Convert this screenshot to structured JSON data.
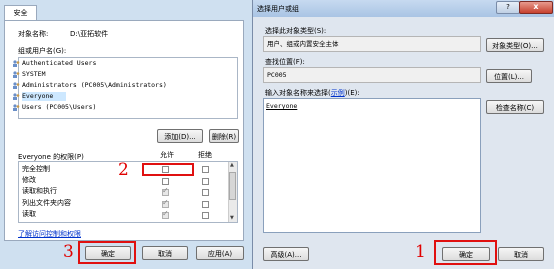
{
  "left_dialog": {
    "tab": "安全",
    "object_label": "对象名称:",
    "object_value": "D:\\亚拓软件",
    "groups_label": "组或用户名(G):",
    "users": [
      "Authenticated Users",
      "SYSTEM",
      "Administrators (PC005\\Administrators)",
      "Everyone",
      "Users (PC005\\Users)"
    ],
    "add_button": "添加(D)...",
    "remove_button": "删除(R)",
    "perm_label": "Everyone 的权限(P)",
    "allow_col": "允许",
    "deny_col": "拒绝",
    "permissions": [
      {
        "name": "完全控制",
        "allow": false,
        "deny": false
      },
      {
        "name": "修改",
        "allow": false,
        "deny": false
      },
      {
        "name": "读取和执行",
        "allow": true,
        "deny": false
      },
      {
        "name": "列出文件夹内容",
        "allow": true,
        "deny": false
      },
      {
        "name": "读取",
        "allow": true,
        "deny": false
      }
    ],
    "link": "了解访问控制和权限",
    "ok": "确定",
    "cancel": "取消",
    "apply": "应用(A)"
  },
  "right_dialog": {
    "title": "选择用户或组",
    "type_label": "选择此对象类型(S):",
    "type_value": "用户、组或内置安全主体",
    "type_button": "对象类型(O)...",
    "location_label": "查找位置(F):",
    "location_value": "PC005",
    "location_button": "位置(L)...",
    "enter_label": "输入对象名称来选择",
    "example_link": "示例",
    "enter_suffix": "(E):",
    "enter_value": "Everyone",
    "check_button": "检查名称(C)",
    "advanced": "高级(A)...",
    "ok": "确定",
    "cancel": "取消",
    "help": "?",
    "close": "x"
  },
  "annotations": [
    "1",
    "2",
    "3"
  ],
  "colors": {
    "accent_red": "#e01010",
    "link_blue": "#0033cc",
    "selection": "#cde8ff"
  }
}
